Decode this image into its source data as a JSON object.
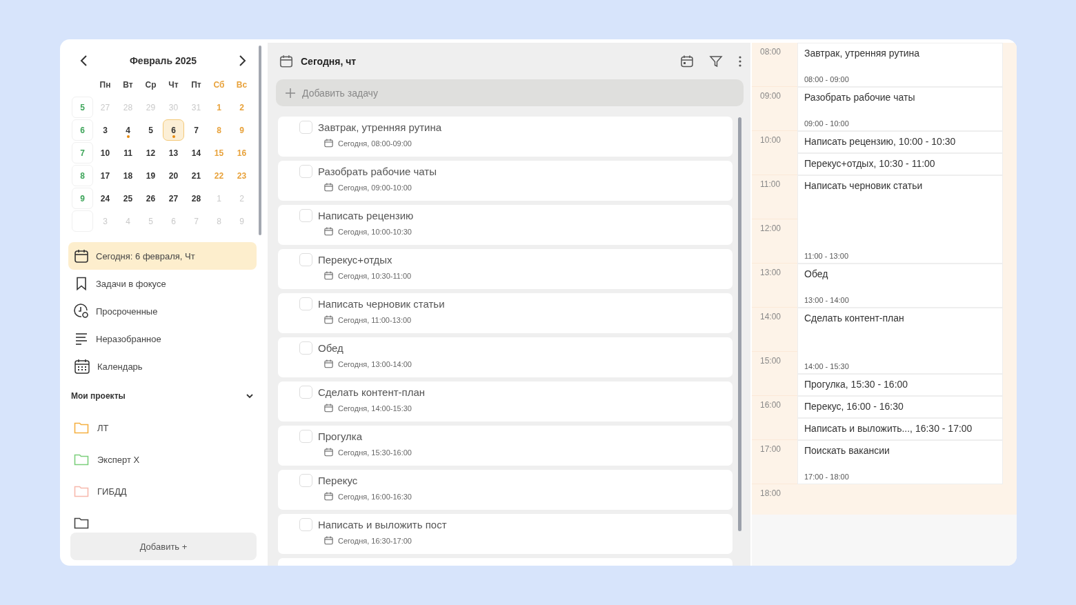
{
  "calendar": {
    "title": "Февраль 2025",
    "weekdays": [
      {
        "label": "Пн",
        "kind": "weekday"
      },
      {
        "label": "Вт",
        "kind": "weekday"
      },
      {
        "label": "Ср",
        "kind": "weekday"
      },
      {
        "label": "Чт",
        "kind": "weekday"
      },
      {
        "label": "Пт",
        "kind": "weekday"
      },
      {
        "label": "Сб",
        "kind": "weekend"
      },
      {
        "label": "Вс",
        "kind": "weekend"
      }
    ],
    "weeks": [
      {
        "number": "5",
        "days": [
          {
            "label": "27",
            "kind": "other",
            "selected": false,
            "marked": false
          },
          {
            "label": "28",
            "kind": "other",
            "selected": false,
            "marked": false
          },
          {
            "label": "29",
            "kind": "other",
            "selected": false,
            "marked": false
          },
          {
            "label": "30",
            "kind": "other",
            "selected": false,
            "marked": false
          },
          {
            "label": "31",
            "kind": "other",
            "selected": false,
            "marked": false
          },
          {
            "label": "1",
            "kind": "weekend",
            "selected": false,
            "marked": false
          },
          {
            "label": "2",
            "kind": "weekend",
            "selected": false,
            "marked": false
          }
        ]
      },
      {
        "number": "6",
        "days": [
          {
            "label": "3",
            "kind": "weekday",
            "selected": false,
            "marked": false
          },
          {
            "label": "4",
            "kind": "weekday",
            "selected": false,
            "marked": true
          },
          {
            "label": "5",
            "kind": "weekday",
            "selected": false,
            "marked": false
          },
          {
            "label": "6",
            "kind": "weekday",
            "selected": true,
            "marked": true
          },
          {
            "label": "7",
            "kind": "weekday",
            "selected": false,
            "marked": false
          },
          {
            "label": "8",
            "kind": "weekend",
            "selected": false,
            "marked": false
          },
          {
            "label": "9",
            "kind": "weekend",
            "selected": false,
            "marked": false
          }
        ]
      },
      {
        "number": "7",
        "days": [
          {
            "label": "10",
            "kind": "weekday",
            "selected": false,
            "marked": false
          },
          {
            "label": "11",
            "kind": "weekday",
            "selected": false,
            "marked": false
          },
          {
            "label": "12",
            "kind": "weekday",
            "selected": false,
            "marked": false
          },
          {
            "label": "13",
            "kind": "weekday",
            "selected": false,
            "marked": false
          },
          {
            "label": "14",
            "kind": "weekday",
            "selected": false,
            "marked": false
          },
          {
            "label": "15",
            "kind": "weekend",
            "selected": false,
            "marked": false
          },
          {
            "label": "16",
            "kind": "weekend",
            "selected": false,
            "marked": false
          }
        ]
      },
      {
        "number": "8",
        "days": [
          {
            "label": "17",
            "kind": "weekday",
            "selected": false,
            "marked": false
          },
          {
            "label": "18",
            "kind": "weekday",
            "selected": false,
            "marked": false
          },
          {
            "label": "19",
            "kind": "weekday",
            "selected": false,
            "marked": false
          },
          {
            "label": "20",
            "kind": "weekday",
            "selected": false,
            "marked": false
          },
          {
            "label": "21",
            "kind": "weekday",
            "selected": false,
            "marked": false
          },
          {
            "label": "22",
            "kind": "weekend",
            "selected": false,
            "marked": false
          },
          {
            "label": "23",
            "kind": "weekend",
            "selected": false,
            "marked": false
          }
        ]
      },
      {
        "number": "9",
        "days": [
          {
            "label": "24",
            "kind": "weekday",
            "selected": false,
            "marked": false
          },
          {
            "label": "25",
            "kind": "weekday",
            "selected": false,
            "marked": false
          },
          {
            "label": "26",
            "kind": "weekday",
            "selected": false,
            "marked": false
          },
          {
            "label": "27",
            "kind": "weekday",
            "selected": false,
            "marked": false
          },
          {
            "label": "28",
            "kind": "weekday",
            "selected": false,
            "marked": false
          },
          {
            "label": "1",
            "kind": "other",
            "selected": false,
            "marked": false
          },
          {
            "label": "2",
            "kind": "other",
            "selected": false,
            "marked": false
          }
        ]
      },
      {
        "days": [
          {
            "label": "3",
            "kind": "other",
            "selected": false,
            "marked": false
          },
          {
            "label": "4",
            "kind": "other",
            "selected": false,
            "marked": false
          },
          {
            "label": "5",
            "kind": "other",
            "selected": false,
            "marked": false
          },
          {
            "label": "6",
            "kind": "other",
            "selected": false,
            "marked": false
          },
          {
            "label": "7",
            "kind": "other",
            "selected": false,
            "marked": false
          },
          {
            "label": "8",
            "kind": "other",
            "selected": false,
            "marked": false
          },
          {
            "label": "9",
            "kind": "other",
            "selected": false,
            "marked": false
          }
        ]
      }
    ]
  },
  "nav": [
    {
      "label": "Сегодня: 6 февраля, Чт",
      "kind": "today",
      "selected": true
    },
    {
      "label": "Задачи в фокусе",
      "kind": "focus",
      "selected": false
    },
    {
      "label": "Просроченные",
      "kind": "overdue",
      "selected": false
    },
    {
      "label": "Неразобранное",
      "kind": "inbox",
      "selected": false
    },
    {
      "label": "Календарь",
      "kind": "calendar",
      "selected": false
    }
  ],
  "projects": {
    "title": "Мои проекты",
    "expanded": true,
    "items": [
      {
        "label": "ЛТ",
        "color": "#f5b041"
      },
      {
        "label": "Эксперт Х",
        "color": "#7ccf7c"
      },
      {
        "label": "ГИБДД",
        "color": "#f7b9ad"
      },
      {
        "color": "#444444"
      }
    ]
  },
  "add_button": "Добавить +",
  "tasks_panel": {
    "title": "Сегодня, чт",
    "add_placeholder": "Добавить задачу",
    "tasks": [
      {
        "title": "Завтрак, утренняя рутина",
        "date": "Сегодня, 08:00-09:00",
        "checked": false
      },
      {
        "title": "Разобрать рабочие чаты",
        "date": "Сегодня, 09:00-10:00",
        "checked": false
      },
      {
        "title": "Написать рецензию",
        "date": "Сегодня, 10:00-10:30",
        "checked": false
      },
      {
        "title": "Перекус+отдых",
        "date": "Сегодня, 10:30-11:00",
        "checked": false
      },
      {
        "title": "Написать черновик статьи",
        "date": "Сегодня, 11:00-13:00",
        "checked": false
      },
      {
        "title": "Обед",
        "date": "Сегодня, 13:00-14:00",
        "checked": false
      },
      {
        "title": "Сделать контент-план",
        "date": "Сегодня, 14:00-15:30",
        "checked": false
      },
      {
        "title": "Прогулка",
        "date": "Сегодня, 15:30-16:00",
        "checked": false
      },
      {
        "title": "Перекус",
        "date": "Сегодня, 16:00-16:30",
        "checked": false
      },
      {
        "title": "Написать и выложить пост",
        "date": "Сегодня, 16:30-17:00",
        "checked": false
      }
    ]
  },
  "timeline": {
    "hours": [
      "08:00",
      "09:00",
      "10:00",
      "11:00",
      "12:00",
      "13:00",
      "14:00",
      "15:00",
      "16:00",
      "17:00",
      "18:00"
    ],
    "events": [
      {
        "title": "Завтрак, утренняя рутина",
        "time": "08:00 - 09:00",
        "kind": "hour"
      },
      {
        "title": "Разобрать рабочие чаты",
        "time": "09:00 - 10:00",
        "kind": "hour"
      },
      {
        "title": "Написать рецензию, 10:00 - 10:30",
        "kind": "half"
      },
      {
        "title": "Перекус+отдых, 10:30 - 11:00",
        "kind": "half"
      },
      {
        "title": "Написать черновик статьи",
        "time": "11:00 - 13:00",
        "kind": "two_hours"
      },
      {
        "title": "Обед",
        "time": "13:00 - 14:00",
        "kind": "hour"
      },
      {
        "title": "Сделать контент-план",
        "time": "14:00 - 15:30",
        "kind": "hour_half"
      },
      {
        "title": "Прогулка, 15:30 - 16:00",
        "kind": "half"
      },
      {
        "title": "Перекус, 16:00 - 16:30",
        "kind": "half"
      },
      {
        "title": "Написать и выложить..., 16:30 - 17:00",
        "kind": "half"
      },
      {
        "title": "Поискать вакансии",
        "time": "17:00 - 18:00",
        "kind": "hour"
      }
    ]
  }
}
